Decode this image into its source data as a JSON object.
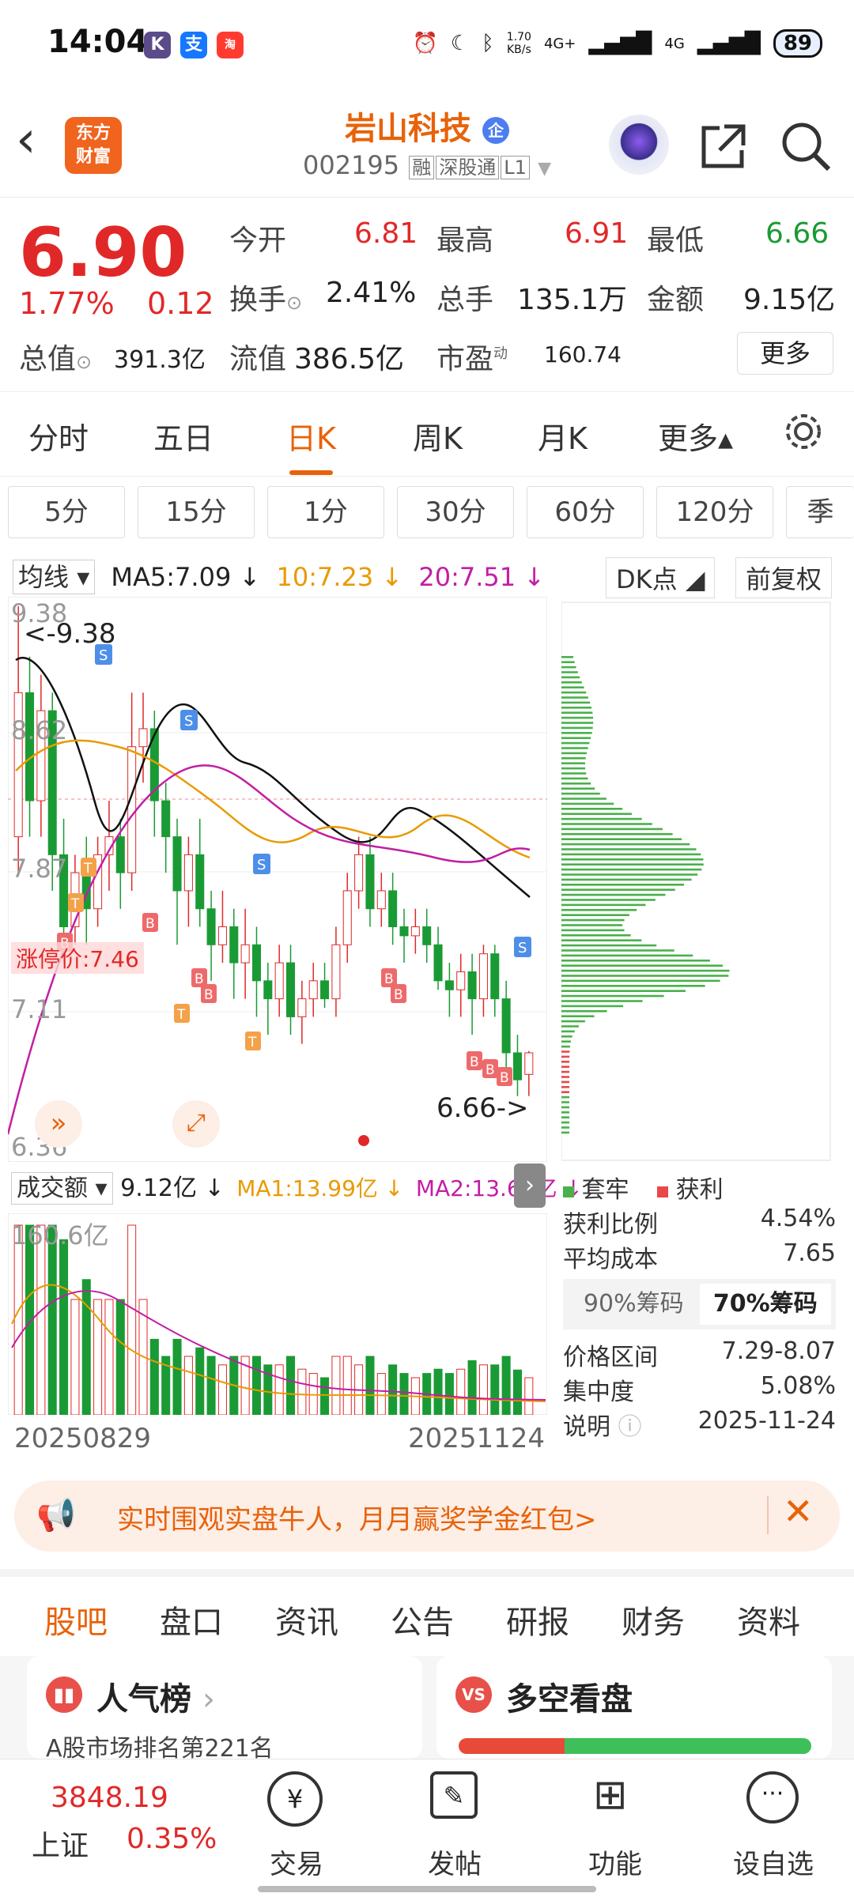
{
  "status": {
    "time": "14:04",
    "net_speed": "1.70\nKB/s",
    "signal1": "4G+",
    "signal2": "4G",
    "battery": "89"
  },
  "header": {
    "logo_text": "东方\n财富",
    "title": "岩山科技",
    "title_badge": "企",
    "code": "002195",
    "tags": [
      "融",
      "深股通",
      "L1"
    ]
  },
  "quote": {
    "price": "6.90",
    "change_pct": "1.77%",
    "change": "0.12",
    "fields": [
      {
        "label": "今开",
        "value": "6.81",
        "color": "red"
      },
      {
        "label": "最高",
        "value": "6.91",
        "color": "red"
      },
      {
        "label": "最低",
        "value": "6.66",
        "color": "green"
      },
      {
        "label": "换手",
        "value": "2.41%",
        "color": "plain"
      },
      {
        "label": "总手",
        "value": "135.1万",
        "color": "plain"
      },
      {
        "label": "金额",
        "value": "9.15亿",
        "color": "plain"
      },
      {
        "label": "总值",
        "value": "391.3亿",
        "color": "plain"
      },
      {
        "label": "流值",
        "value": "386.5亿",
        "color": "plain"
      },
      {
        "label": "市盈",
        "value": "160.74",
        "color": "plain"
      }
    ],
    "pe_superscript": "动",
    "more_label": "更多"
  },
  "ktabs": [
    {
      "label": "分时"
    },
    {
      "label": "五日"
    },
    {
      "label": "日K",
      "active": true
    },
    {
      "label": "周K"
    },
    {
      "label": "月K"
    },
    {
      "label": "更多▴"
    }
  ],
  "periods": [
    "5分",
    "15分",
    "1分",
    "30分",
    "60分",
    "120分",
    "季"
  ],
  "ma": {
    "selector": "均线",
    "ma5": "MA5:7.09 ↓",
    "ma10": "10:7.23 ↓",
    "ma20": "20:7.51 ↓",
    "dk": "DK点",
    "adjust": "前复权"
  },
  "chart_labels": {
    "y_top": "9.38",
    "high_marker": "<-9.38",
    "y2": "8.62",
    "y3": "7.87",
    "limit_label": "涨停价:7.46",
    "y4": "7.11",
    "y_bottom": "6.36",
    "low_marker": "6.66->"
  },
  "volume": {
    "selector": "成交额",
    "value": "9.12亿 ↓",
    "ma1": "MA1:13.99亿 ↓",
    "ma2": "MA2:13.63亿 ↓",
    "y_top": "160.6亿",
    "date_start": "20250829",
    "date_end": "20251124"
  },
  "chip": {
    "legend_trapped": "套牢",
    "legend_profit": "获利",
    "rows": [
      {
        "label": "获利比例",
        "value": "4.54%"
      },
      {
        "label": "平均成本",
        "value": "7.65"
      }
    ],
    "tab90": "90%筹码",
    "tab70": "70%筹码",
    "rows2": [
      {
        "label": "价格区间",
        "value": "7.29-8.07"
      },
      {
        "label": "集中度",
        "value": "5.08%"
      },
      {
        "label": "说明",
        "value": "2025-11-24"
      }
    ]
  },
  "banner": {
    "text": "实时围观实盘牛人，月月赢奖学金红包>"
  },
  "stabs": [
    {
      "label": "股吧",
      "active": true
    },
    {
      "label": "盘口"
    },
    {
      "label": "资讯"
    },
    {
      "label": "公告"
    },
    {
      "label": "研报"
    },
    {
      "label": "财务"
    },
    {
      "label": "资料"
    }
  ],
  "cards": {
    "left_title": "人气榜",
    "left_sub": "A股市场排名第221名",
    "right_title": "多空看盘"
  },
  "bottom": {
    "index_value": "3848.19",
    "index_name": "上证",
    "index_change": "0.35%",
    "items": [
      "交易",
      "发帖",
      "功能",
      "设自选"
    ]
  },
  "chart_data": {
    "type": "candlestick",
    "y_range": [
      6.36,
      9.38
    ],
    "candles": [
      {
        "o": 8.1,
        "c": 8.9,
        "h": 9.38,
        "l": 7.9
      },
      {
        "o": 8.9,
        "c": 8.3,
        "h": 9.1,
        "l": 8.1
      },
      {
        "o": 8.3,
        "c": 8.8,
        "h": 9.0,
        "l": 8.1
      },
      {
        "o": 8.8,
        "c": 8.0,
        "h": 8.9,
        "l": 7.8
      },
      {
        "o": 8.0,
        "c": 7.6,
        "h": 8.2,
        "l": 7.4
      },
      {
        "o": 7.6,
        "c": 7.9,
        "h": 8.0,
        "l": 7.5
      },
      {
        "o": 7.9,
        "c": 7.7,
        "h": 8.1,
        "l": 7.5
      },
      {
        "o": 7.7,
        "c": 8.0,
        "h": 8.1,
        "l": 7.6
      },
      {
        "o": 8.0,
        "c": 8.1,
        "h": 8.3,
        "l": 7.8
      },
      {
        "o": 8.1,
        "c": 7.9,
        "h": 8.2,
        "l": 7.7
      },
      {
        "o": 7.9,
        "c": 8.6,
        "h": 8.9,
        "l": 7.8
      },
      {
        "o": 8.6,
        "c": 8.7,
        "h": 8.9,
        "l": 8.4
      },
      {
        "o": 8.7,
        "c": 8.3,
        "h": 8.8,
        "l": 8.1
      },
      {
        "o": 8.3,
        "c": 8.1,
        "h": 8.4,
        "l": 7.9
      },
      {
        "o": 8.1,
        "c": 7.8,
        "h": 8.2,
        "l": 7.5
      },
      {
        "o": 7.8,
        "c": 8.0,
        "h": 8.1,
        "l": 7.6
      },
      {
        "o": 8.0,
        "c": 7.7,
        "h": 8.2,
        "l": 7.6
      },
      {
        "o": 7.7,
        "c": 7.5,
        "h": 7.8,
        "l": 7.3
      },
      {
        "o": 7.5,
        "c": 7.6,
        "h": 7.8,
        "l": 7.4
      },
      {
        "o": 7.6,
        "c": 7.4,
        "h": 7.7,
        "l": 7.2
      },
      {
        "o": 7.4,
        "c": 7.5,
        "h": 7.7,
        "l": 7.2
      },
      {
        "o": 7.5,
        "c": 7.3,
        "h": 7.6,
        "l": 7.1
      },
      {
        "o": 7.3,
        "c": 7.2,
        "h": 7.4,
        "l": 7.0
      },
      {
        "o": 7.2,
        "c": 7.4,
        "h": 7.5,
        "l": 7.1
      },
      {
        "o": 7.4,
        "c": 7.1,
        "h": 7.5,
        "l": 7.0
      },
      {
        "o": 7.1,
        "c": 7.2,
        "h": 7.3,
        "l": 6.95
      },
      {
        "o": 7.2,
        "c": 7.3,
        "h": 7.4,
        "l": 7.1
      },
      {
        "o": 7.3,
        "c": 7.2,
        "h": 7.4,
        "l": 7.15
      },
      {
        "o": 7.2,
        "c": 7.5,
        "h": 7.6,
        "l": 7.1
      },
      {
        "o": 7.5,
        "c": 7.8,
        "h": 7.9,
        "l": 7.4
      },
      {
        "o": 7.8,
        "c": 8.0,
        "h": 8.1,
        "l": 7.7
      },
      {
        "o": 8.0,
        "c": 7.7,
        "h": 8.1,
        "l": 7.6
      },
      {
        "o": 7.7,
        "c": 7.8,
        "h": 7.9,
        "l": 7.6
      },
      {
        "o": 7.8,
        "c": 7.6,
        "h": 7.9,
        "l": 7.5
      },
      {
        "o": 7.6,
        "c": 7.55,
        "h": 7.7,
        "l": 7.4
      },
      {
        "o": 7.55,
        "c": 7.6,
        "h": 7.7,
        "l": 7.45
      },
      {
        "o": 7.6,
        "c": 7.5,
        "h": 7.7,
        "l": 7.4
      },
      {
        "o": 7.5,
        "c": 7.3,
        "h": 7.6,
        "l": 7.25
      },
      {
        "o": 7.3,
        "c": 7.25,
        "h": 7.4,
        "l": 7.1
      },
      {
        "o": 7.25,
        "c": 7.35,
        "h": 7.45,
        "l": 7.1
      },
      {
        "o": 7.35,
        "c": 7.2,
        "h": 7.45,
        "l": 7.0
      },
      {
        "o": 7.2,
        "c": 7.45,
        "h": 7.5,
        "l": 7.1
      },
      {
        "o": 7.45,
        "c": 7.2,
        "h": 7.5,
        "l": 7.1
      },
      {
        "o": 7.2,
        "c": 6.9,
        "h": 7.3,
        "l": 6.8
      },
      {
        "o": 6.9,
        "c": 6.75,
        "h": 7.0,
        "l": 6.66
      },
      {
        "o": 6.78,
        "c": 6.9,
        "h": 6.91,
        "l": 6.66
      }
    ]
  }
}
